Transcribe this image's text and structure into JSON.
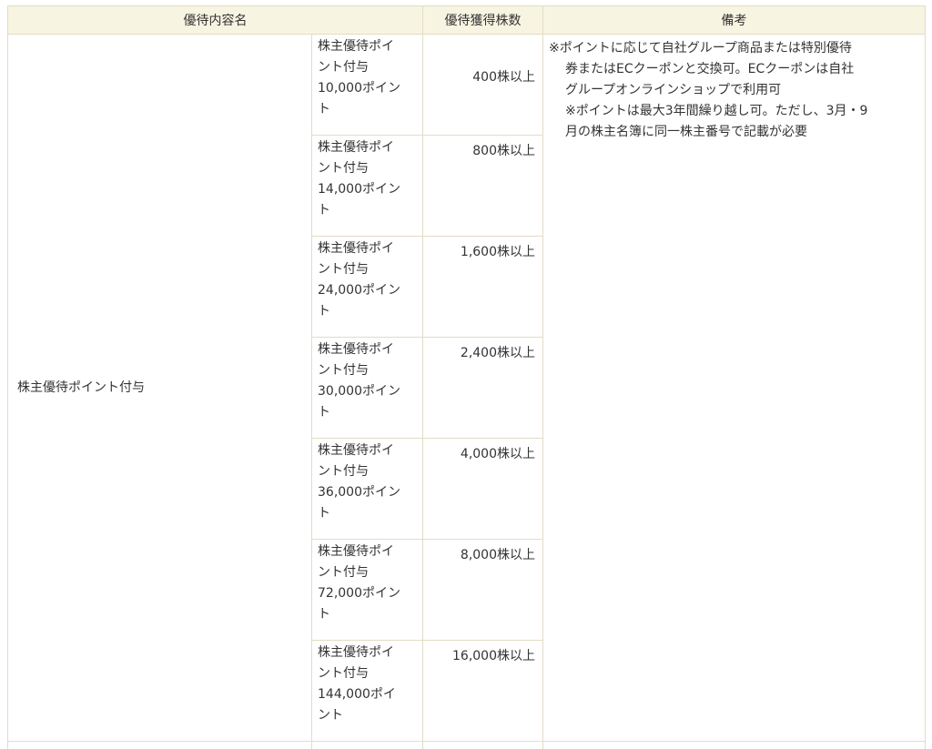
{
  "table": {
    "headers": {
      "name": "優待内容名",
      "shares": "優待獲得株数",
      "note": "備考"
    },
    "benefit_name": "株主優待ポイント付与",
    "rows": [
      {
        "item_lines": [
          "株主優待ポイ",
          "ント付与",
          "10,000ポイン",
          "ト"
        ],
        "shares": "400株以上"
      },
      {
        "item_lines": [
          "株主優待ポイ",
          "ント付与",
          "14,000ポイン",
          "ト"
        ],
        "shares": "800株以上"
      },
      {
        "item_lines": [
          "株主優待ポイ",
          "ント付与",
          "24,000ポイン",
          "ト"
        ],
        "shares": "1,600株以上"
      },
      {
        "item_lines": [
          "株主優待ポイ",
          "ント付与",
          "30,000ポイン",
          "ト"
        ],
        "shares": "2,400株以上"
      },
      {
        "item_lines": [
          "株主優待ポイ",
          "ント付与",
          "36,000ポイン",
          "ト"
        ],
        "shares": "4,000株以上"
      },
      {
        "item_lines": [
          "株主優待ポイ",
          "ント付与",
          "72,000ポイン",
          "ト"
        ],
        "shares": "8,000株以上"
      },
      {
        "item_lines": [
          "株主優待ポイ",
          "ント付与",
          "144,000ポイ",
          "ント"
        ],
        "shares": "16,000株以上"
      }
    ],
    "note_lines": [
      "※ポイントに応じて自社グループ商品または特別優待",
      "券またはECクーポンと交換可。ECクーポンは自社",
      "グループオンラインショップで利用可",
      "※ポイントは最大3年間繰り越し可。ただし、3月・9",
      "月の株主名簿に同一株主番号で記載が必要"
    ]
  }
}
